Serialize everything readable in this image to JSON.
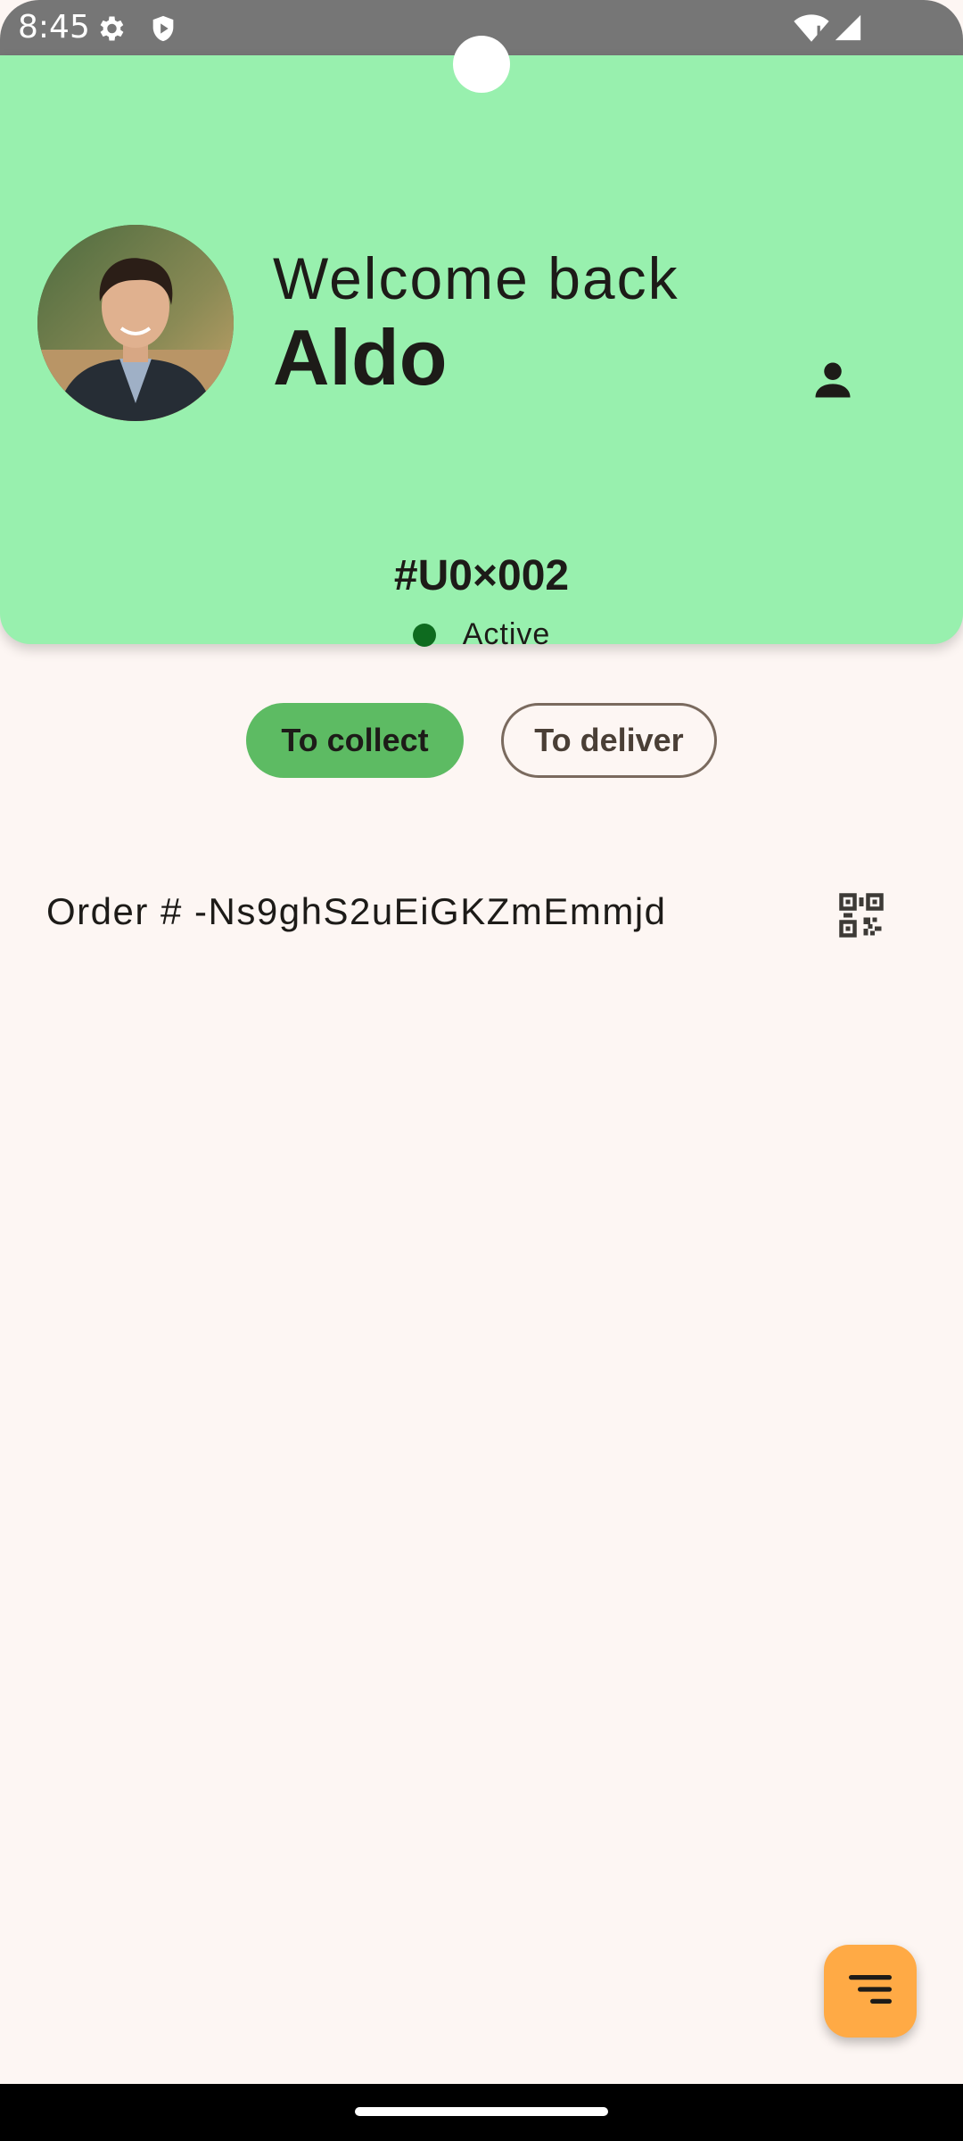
{
  "status_bar": {
    "time": "8:45",
    "icons": [
      "gear-icon",
      "shield-icon",
      "wifi-icon",
      "signal-icon"
    ]
  },
  "header": {
    "welcome_text": "Welcome back",
    "user_name": "Aldo",
    "user_id": "#U0×002",
    "status": "Active",
    "status_color": "#0e6b1f",
    "background_color": "#98f0ae",
    "profile_icon": "person-icon"
  },
  "tabs": [
    {
      "label": "To collect",
      "selected": true
    },
    {
      "label": "To deliver",
      "selected": false
    }
  ],
  "orders": [
    {
      "label": "Order # -Ns9ghS2uEiGKZmEmmjd",
      "action_icon": "qr-code-icon"
    }
  ],
  "fab": {
    "icon": "filter-list-icon",
    "color": "#ffaa45"
  }
}
